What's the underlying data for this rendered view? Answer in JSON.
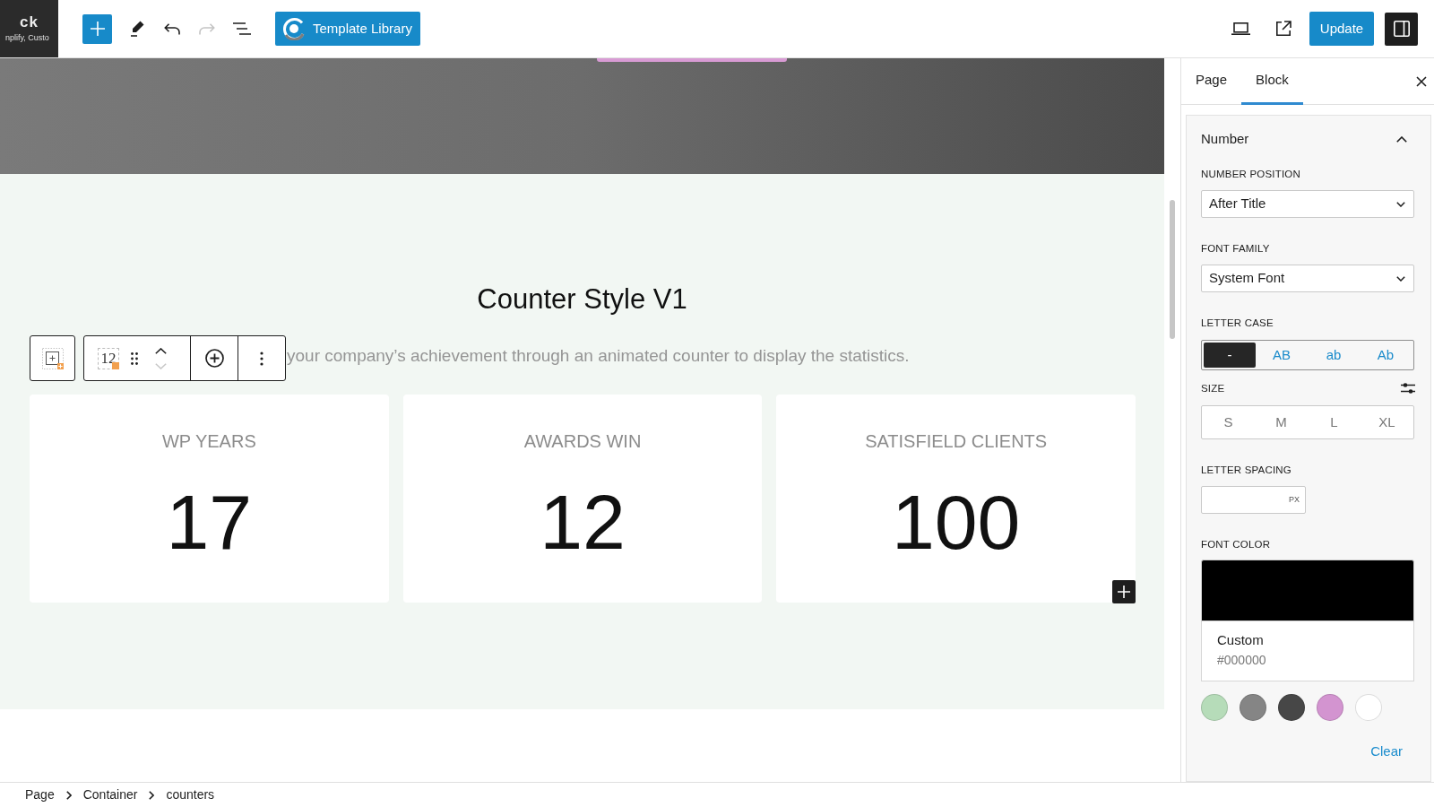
{
  "top_bar": {
    "logo": {
      "title": "ck",
      "tagline": "nplify, Custo"
    },
    "tools": [
      {
        "kind": "add",
        "disabled": false
      },
      {
        "kind": "edit",
        "disabled": false
      },
      {
        "kind": "undo",
        "disabled": false
      },
      {
        "kind": "redo",
        "disabled": true
      },
      {
        "kind": "list",
        "disabled": false
      }
    ],
    "template_button": "Template Library",
    "actions": [
      {
        "kind": "view"
      },
      {
        "kind": "preview"
      }
    ],
    "update_button": "Update",
    "sidebar_toggle": {
      "pressed": true
    }
  },
  "canvas": {
    "heading": "Counter Style V1",
    "subtitle": "your company’s achievement through an animated counter to display the statistics.",
    "counters": [
      {
        "title": "WP YEARS",
        "number": "17"
      },
      {
        "title": "AWARDS WIN",
        "number": "12"
      },
      {
        "title": "SATISFIELD CLIENTS",
        "number": "100"
      }
    ],
    "block_toolbar": {
      "block_icon_label": "12",
      "move_up_disabled": false,
      "move_down_disabled": true
    }
  },
  "sidebar": {
    "tabs": [
      {
        "label": "Page",
        "selected": false
      },
      {
        "label": "Block",
        "selected": true
      }
    ],
    "panel": {
      "title": "Number",
      "expanded": true,
      "fields": [
        {
          "kind": "select",
          "label": "NUMBER POSITION",
          "value": "After Title"
        },
        {
          "kind": "select",
          "label": "FONT FAMILY",
          "value": "System Font"
        },
        {
          "kind": "case_picker",
          "label": "LETTER CASE",
          "options": [
            {
              "label": "-",
              "selected": true
            },
            {
              "label": "AB",
              "selected": false
            },
            {
              "label": "ab",
              "selected": false
            },
            {
              "label": "Ab",
              "selected": false
            }
          ]
        },
        {
          "kind": "size_picker",
          "label": "SIZE",
          "custom_button": true,
          "options": [
            {
              "label": "S",
              "selected": false
            },
            {
              "label": "M",
              "selected": false
            },
            {
              "label": "L",
              "selected": false
            },
            {
              "label": "XL",
              "selected": false
            }
          ]
        },
        {
          "kind": "unit_input",
          "label": "LETTER SPACING",
          "unit": "PX"
        },
        {
          "kind": "color_picker",
          "label": "FONT COLOR",
          "color": "#000000",
          "color_name": "Custom",
          "color_value": "#000000",
          "swatches": [
            {
              "color": "#b6dcb9",
              "selected": false
            },
            {
              "color": "#858585",
              "selected": false
            },
            {
              "color": "#474747",
              "selected": false
            },
            {
              "color": "#d394d0",
              "selected": false
            },
            {
              "color": "#ffffff",
              "selected": false
            }
          ],
          "clear": "Clear"
        }
      ]
    }
  },
  "breadcrumb": [
    "Page",
    "Container",
    "counters"
  ]
}
